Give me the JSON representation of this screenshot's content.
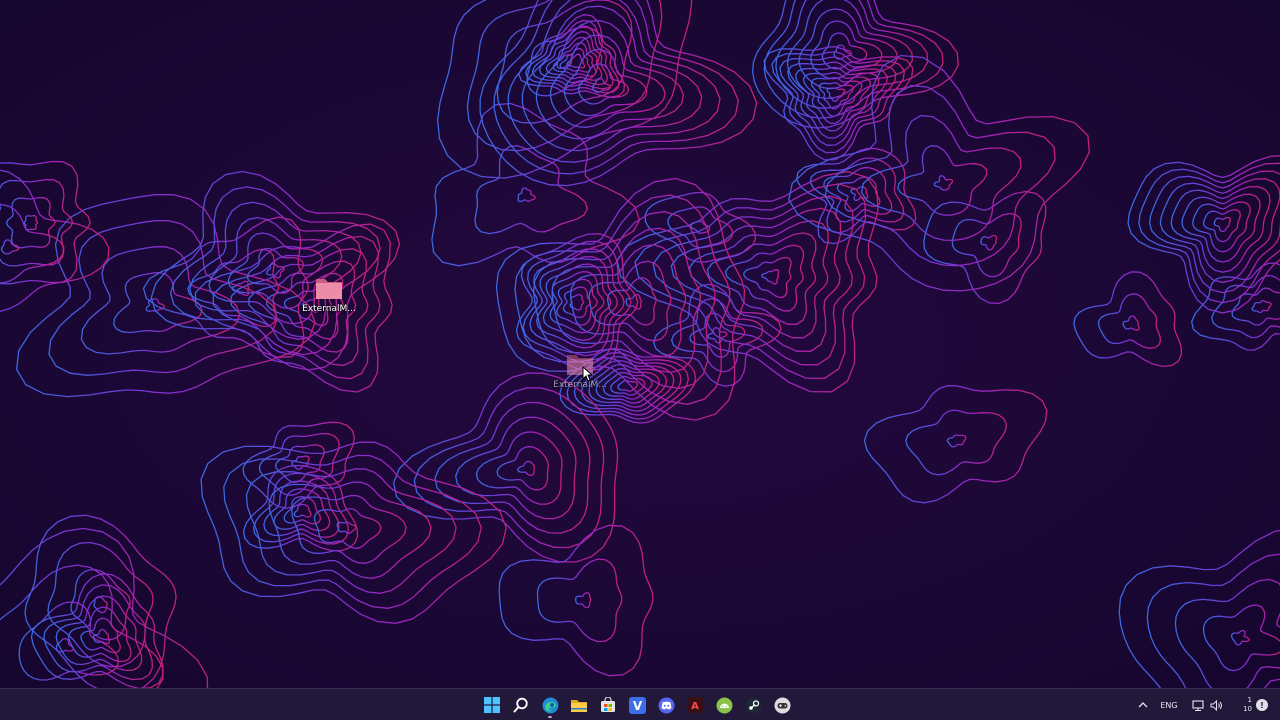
{
  "desktop": {
    "icons": [
      {
        "name": "ExternalM...",
        "state": "normal"
      },
      {
        "name": "ExternalM...",
        "state": "dragging"
      }
    ]
  },
  "taskbar": {
    "pinned": [
      {
        "name": "start",
        "icon": "windows-logo-icon"
      },
      {
        "name": "search",
        "icon": "search-icon"
      },
      {
        "name": "edge",
        "icon": "edge-icon",
        "running": true
      },
      {
        "name": "file-explorer",
        "icon": "folder-icon"
      },
      {
        "name": "store",
        "icon": "store-icon"
      },
      {
        "name": "v-app",
        "icon": "v-app-icon",
        "letter": "V"
      },
      {
        "name": "discord",
        "icon": "discord-icon"
      },
      {
        "name": "a-app",
        "icon": "a-app-icon",
        "letter": "A"
      },
      {
        "name": "android-app",
        "icon": "android-icon"
      },
      {
        "name": "steam",
        "icon": "steam-icon"
      },
      {
        "name": "game-app",
        "icon": "controller-icon"
      }
    ],
    "tray": {
      "language": "ENG",
      "clock_time": "1",
      "clock_date": "10",
      "notification_badge": "!"
    }
  },
  "colors": {
    "background": "#1a0838",
    "contour_blue": "#3f7bff",
    "contour_purple": "#9b3cff",
    "contour_magenta": "#e0257f",
    "folder": "#e9839f",
    "taskbar": "#22183a"
  }
}
